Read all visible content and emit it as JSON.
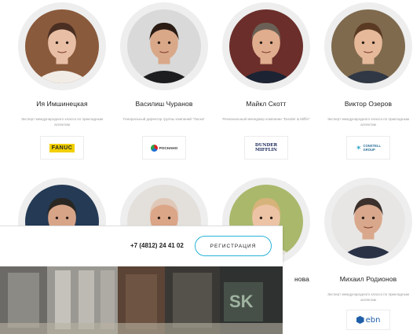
{
  "speakers": [
    {
      "name": "Ия Имшинецкая",
      "role": "Эксперт международного класса по прикладным аспектам",
      "logo": "FANUC",
      "hair": "#4a2e22",
      "skin": "#e8bfa5",
      "shirt": "#f1ece6"
    },
    {
      "name": "Василиш Чуранов",
      "role": "Генеральный директор группы компаний \"Ласка\"",
      "logo": "РОСНАНО",
      "hair": "#2a1c14",
      "skin": "#d9a889",
      "shirt": "#1d1d1f"
    },
    {
      "name": "Майкл Скотт",
      "role": "Региональный менеджер компании \"Dunder & Miflin\"",
      "logo": "DUNDER MIFFLIN",
      "hair": "#6b6055",
      "skin": "#e0ad8e",
      "shirt": "#1c2333"
    },
    {
      "name": "Виктор Озеров",
      "role": "Эксперт международного класса по прикладным аспектам",
      "logo": "CONSTELL GROUP",
      "hair": "#5a3a22",
      "skin": "#e6b99a",
      "shirt": "#303845"
    },
    {
      "name": "",
      "role": "",
      "hair": "#2a2622",
      "skin": "#d8a488",
      "shirt": "#2f3440"
    },
    {
      "name": "",
      "role": "",
      "hair": "#e0c8b8",
      "skin": "#dba587",
      "shirt": "#c9c3bd"
    },
    {
      "name": "нова",
      "role": "",
      "hair": "#d6b37a",
      "skin": "#edc3a6",
      "shirt": "#e7e2dc"
    },
    {
      "name": "Михаил Родионов",
      "role": "Эксперт международного класса по прикладным аспектам",
      "logo": "ebn",
      "hair": "#3b302b",
      "skin": "#d9a88c",
      "shirt": "#2a3246"
    }
  ],
  "header": {
    "phone": "+7 (4812) 24 41 02",
    "register_label": "РЕГИСТРАЦИЯ"
  },
  "logos": {
    "fanuc": "FANUC",
    "rosnano": "РОСНАНО",
    "dunder_line1": "DUNDER",
    "dunder_line2": "MIFFLIN",
    "constell_line1": "CONSTELL",
    "constell_line2": "GROUP",
    "ebn": "ebn"
  },
  "colors": {
    "accent": "#2ab3d8",
    "ring": "#eeeeee"
  }
}
